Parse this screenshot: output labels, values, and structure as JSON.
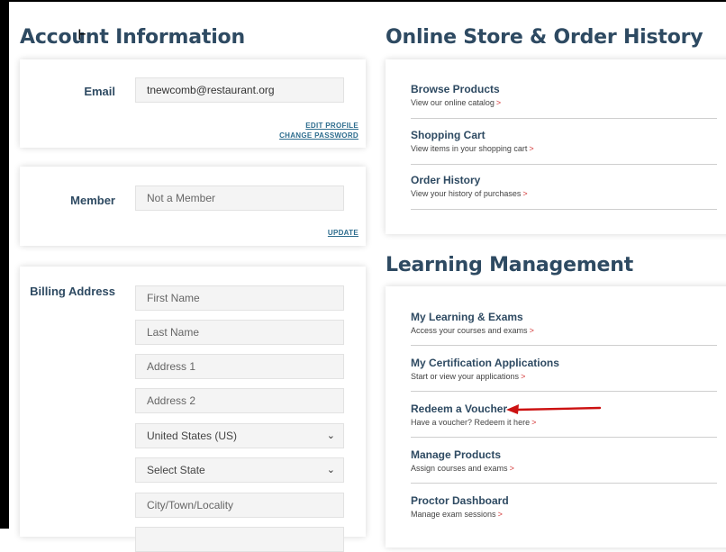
{
  "account": {
    "heading": "Account Information",
    "email_label": "Email",
    "email_value": "tnewcomb@restaurant.org",
    "edit_profile": "EDIT PROFILE",
    "change_password": "CHANGE PASSWORD",
    "member_label": "Member",
    "member_value": "Not a Member",
    "update": "UPDATE",
    "billing_label": "Billing Address",
    "billing": {
      "first_name": "First Name",
      "last_name": "Last Name",
      "address1": "Address 1",
      "address2": "Address 2",
      "country": "United States (US)",
      "state": "Select State",
      "city": "City/Town/Locality"
    }
  },
  "store": {
    "heading": "Online Store & Order History",
    "items": [
      {
        "title": "Browse Products",
        "desc": "View our online catalog"
      },
      {
        "title": "Shopping Cart",
        "desc": "View items in your shopping cart"
      },
      {
        "title": "Order History",
        "desc": "View your history of purchases"
      }
    ]
  },
  "learning": {
    "heading": "Learning Management",
    "items": [
      {
        "title": "My Learning & Exams",
        "desc": "Access your courses and exams"
      },
      {
        "title": "My Certification Applications",
        "desc": "Start or view your applications"
      },
      {
        "title": "Redeem a Voucher",
        "desc": "Have a voucher? Redeem it here"
      },
      {
        "title": "Manage Products",
        "desc": "Assign courses and exams"
      },
      {
        "title": "Proctor Dashboard",
        "desc": "Manage exam sessions"
      }
    ]
  },
  "glyphs": {
    "link_arrow": ">",
    "select_chevron": "⌄",
    "text_cursor": "Ⱶ"
  },
  "colors": {
    "heading": "#2e4a62",
    "link": "#2e6d8e",
    "accent_red": "#d43a3a",
    "annotation_arrow": "#cc1111"
  }
}
